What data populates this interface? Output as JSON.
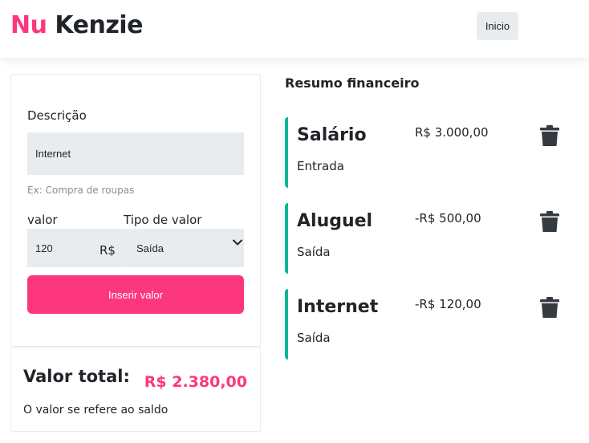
{
  "header": {
    "logo_nu": "Nu",
    "logo_kenzie": "Kenzie",
    "home_button": "Inicio"
  },
  "form": {
    "description_label": "Descrição",
    "description_value": "Internet",
    "description_hint": "Ex: Compra de roupas",
    "value_label": "valor",
    "value_value": "120",
    "currency": "R$",
    "type_label": "Tipo de valor",
    "type_selected": "Saída",
    "submit_label": "Inserir valor"
  },
  "total": {
    "label": "Valor total:",
    "value": "R$ 2.380,00",
    "note": "O valor se refere ao saldo"
  },
  "summary": {
    "title": "Resumo financeiro",
    "entries": [
      {
        "title": "Salário",
        "amount": "R$ 3.000,00",
        "type": "Entrada"
      },
      {
        "title": "Aluguel",
        "amount": "-R$ 500,00",
        "type": "Saída"
      },
      {
        "title": "Internet",
        "amount": "-R$ 120,00",
        "type": "Saída"
      }
    ]
  },
  "colors": {
    "brand": "#fd377e",
    "accent": "#03b898",
    "input_bg": "#e9ecef"
  },
  "icons": [
    "trash-icon",
    "chevron-down-icon"
  ]
}
